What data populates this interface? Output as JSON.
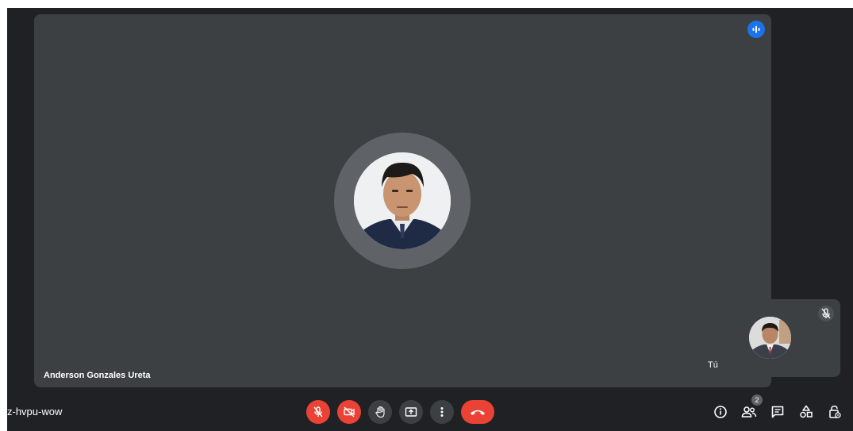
{
  "main_participant": {
    "name": "Anderson Gonzales Ureta",
    "speaking": true
  },
  "self_tile": {
    "label": "Tú",
    "muted": true
  },
  "meeting": {
    "code": "z-hvpu-wow"
  },
  "controls": [
    {
      "icon": "mic-off-icon",
      "state": "off",
      "color": "#ea4335"
    },
    {
      "icon": "camera-off-icon",
      "state": "off",
      "color": "#ea4335"
    },
    {
      "icon": "raise-hand-icon"
    },
    {
      "icon": "present-screen-icon"
    },
    {
      "icon": "more-options-icon"
    },
    {
      "icon": "hang-up-icon",
      "color": "#ea4335"
    }
  ],
  "side_controls": {
    "participants_count": "2",
    "icons": [
      "info-icon",
      "people-icon",
      "chat-icon",
      "activities-icon",
      "host-controls-icon"
    ]
  },
  "colors": {
    "background": "#202124",
    "tile": "#3c4043",
    "danger": "#ea4335",
    "accent": "#1a73e8"
  }
}
